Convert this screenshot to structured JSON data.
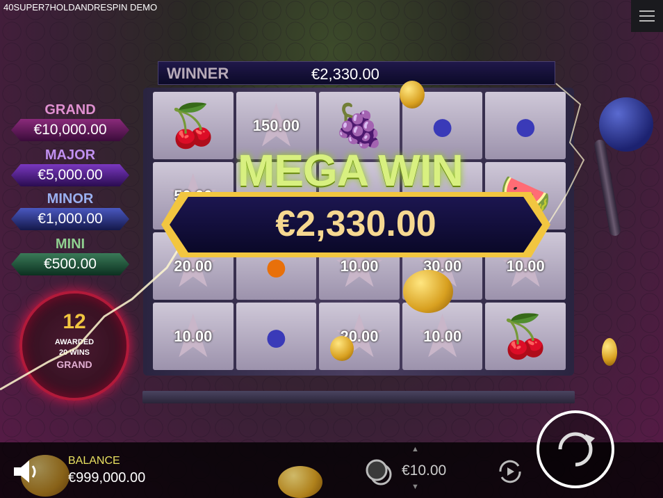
{
  "window": {
    "title": "40SUPER7HOLDANDRESPIN DEMO"
  },
  "winner": {
    "label": "WINNER",
    "value": "€2,330.00"
  },
  "jackpots": {
    "grand": {
      "label": "GRAND",
      "value": "€10,000.00"
    },
    "major": {
      "label": "MAJOR",
      "value": "€5,000.00"
    },
    "minor": {
      "label": "MINOR",
      "value": "€1,000.00"
    },
    "mini": {
      "label": "MINI",
      "value": "€500.00"
    }
  },
  "awarded": {
    "count": "12",
    "line1": "AWARDED",
    "line2": "20 WINS",
    "jackpot": "GRAND"
  },
  "mega_win": {
    "title": "MEGA WIN",
    "amount": "€2,330.00"
  },
  "reels": {
    "row1": {
      "c2": "150.00"
    },
    "row2": {
      "c1": "50.00"
    },
    "row3": {
      "c1": "20.00",
      "c3": "10.00",
      "c4": "30.00",
      "c5": "10.00"
    },
    "row4": {
      "c1": "10.00",
      "c3": "20.00",
      "c4": "10.00"
    }
  },
  "bottom": {
    "balance_label": "BALANCE",
    "balance_value": "€999,000.00",
    "bet_value": "€10.00"
  },
  "icons": [
    "menu-icon",
    "speaker-icon",
    "chips-icon",
    "autoplay-icon",
    "spin-icon",
    "lever-icon"
  ],
  "colors": {
    "accent_gold": "#f2c640",
    "mega_green": "#d8f080",
    "balance_label": "#e8e060"
  }
}
